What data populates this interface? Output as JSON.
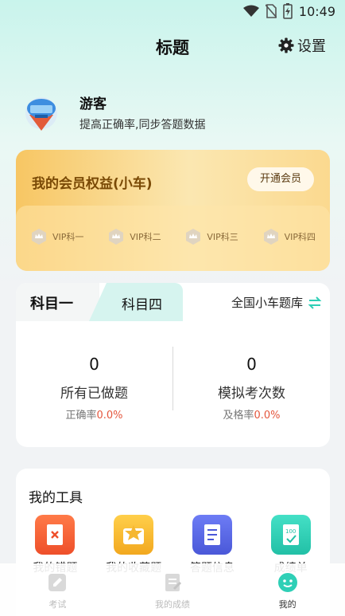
{
  "status": {
    "time": "10:49"
  },
  "header": {
    "title": "标题",
    "settings_label": "设置"
  },
  "user": {
    "name": "游客",
    "subtitle": "提高正确率,同步答题数据"
  },
  "vip": {
    "title": "我的会员权益(小车)",
    "open_label": "开通会员",
    "items": [
      "VIP科一",
      "VIP科二",
      "VIP科三",
      "VIP科四"
    ]
  },
  "subject": {
    "tabs": [
      "科目一",
      "科目四"
    ],
    "active_tab": 0,
    "library_label": "全国小车题库",
    "stats": [
      {
        "value": "0",
        "label": "所有已做题",
        "rate_label": "正确率",
        "rate_value": "0.0%"
      },
      {
        "value": "0",
        "label": "模拟考次数",
        "rate_label": "及格率",
        "rate_value": "0.0%"
      }
    ]
  },
  "tools": {
    "title": "我的工具",
    "items": [
      {
        "label": "我的错题",
        "icon": "wrong-questions-icon",
        "color": "#f2643a"
      },
      {
        "label": "我的收藏题",
        "icon": "favorites-icon",
        "color": "#f5b731"
      },
      {
        "label": "答题信息",
        "icon": "answer-info-icon",
        "color": "#5b6be8"
      },
      {
        "label": "成绩单",
        "icon": "score-sheet-icon",
        "color": "#2ecfb6"
      }
    ]
  },
  "nav": {
    "items": [
      {
        "label": "考试",
        "icon": "exam-icon"
      },
      {
        "label": "我的成绩",
        "icon": "my-scores-icon"
      },
      {
        "label": "我的",
        "icon": "mine-icon"
      }
    ],
    "active": 2
  },
  "colors": {
    "accent": "#2ecfb6",
    "vip_gold": "#f7c663",
    "rate_red": "#e4563d"
  }
}
